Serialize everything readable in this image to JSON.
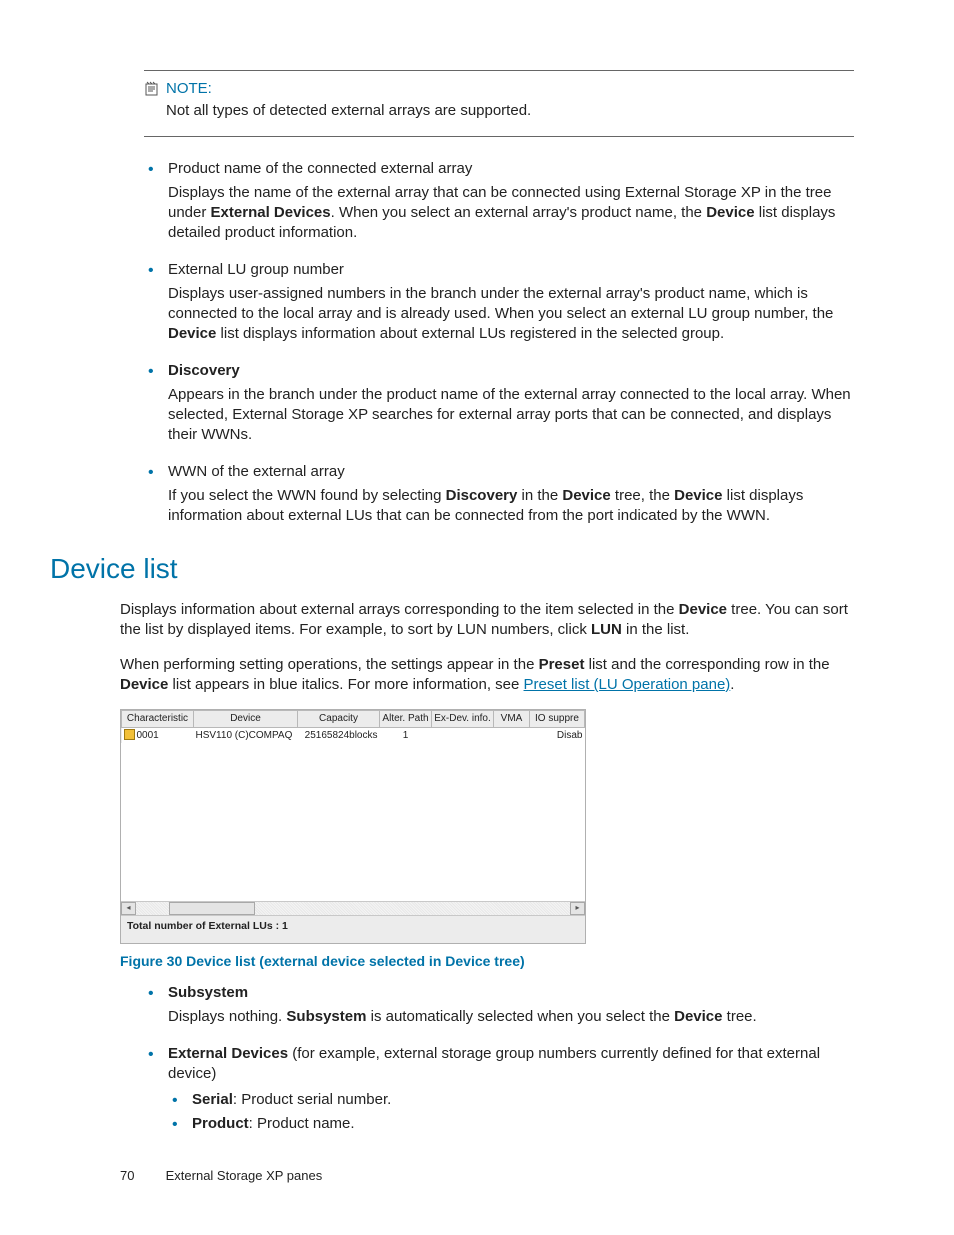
{
  "note": {
    "label": "NOTE:",
    "text": "Not all types of detected external arrays are supported."
  },
  "items": {
    "i0": {
      "head_a": "Product name of the connected external array",
      "body_a": "Displays the name of the external array that can be connected using External Storage XP in the tree under ",
      "body_b": "External Devices",
      "body_c": ". When you select an external array's product name, the ",
      "body_d": "Device",
      "body_e": " list displays detailed product information."
    },
    "i1": {
      "head_a": "External LU group number",
      "body_a": "Displays user-assigned numbers in the branch under the external array's product name, which is connected to the local array and is already used. When you select an external LU group number, the ",
      "body_b": "Device",
      "body_c": " list displays information about external LUs registered in the selected group."
    },
    "i2": {
      "head_a": "Discovery",
      "body_a": "Appears in the branch under the product name of the external array connected to the local array. When selected, External Storage XP searches for external array ports that can be connected, and displays their WWNs."
    },
    "i3": {
      "head_a": "WWN of the external array",
      "body_a": "If you select the WWN found by selecting ",
      "body_b": "Discovery",
      "body_c": " in the ",
      "body_d": "Device",
      "body_e": " tree, the ",
      "body_f": "Device",
      "body_g": " list displays information about external LUs that can be connected from the port indicated by the WWN."
    }
  },
  "section_heading": "Device list",
  "p1": {
    "a": "Displays information about external arrays corresponding to the item selected in the ",
    "b": "Device",
    "c": " tree. You can sort the list by displayed items. For example, to sort by LUN numbers, click ",
    "d": "LUN",
    "e": " in the list."
  },
  "p2": {
    "a": "When performing setting operations, the settings appear in the ",
    "b": "Preset",
    "c": " list and the corresponding row in the ",
    "d": "Device",
    "e": " list appears in blue italics. For more information, see ",
    "link": "Preset list (LU Operation pane)",
    "f": "."
  },
  "table": {
    "headers": [
      "Characteristic",
      "Device",
      "Capacity",
      "Alter. Path",
      "Ex-Dev. info.",
      "VMA",
      "IO suppre"
    ],
    "row": {
      "c0": "0001",
      "c1": "HSV110 (C)COMPAQ",
      "c2": "25165824blocks",
      "c3": "1",
      "c4": "",
      "c5": "",
      "c6": "Disab"
    },
    "footer": "Total number of External LUs : 1"
  },
  "caption": "Figure 30 Device list (external device selected in Device tree)",
  "items2": {
    "s0": {
      "head": "Subsystem",
      "body_a": "Displays nothing. ",
      "body_b": "Subsystem",
      "body_c": " is automatically selected when you select the ",
      "body_d": "Device",
      "body_e": " tree."
    },
    "s1": {
      "head": "External Devices",
      "body_a": " (for example, external storage group numbers currently defined for that external device)",
      "sub0_b": "Serial",
      "sub0_t": ": Product serial number.",
      "sub1_b": "Product",
      "sub1_t": ": Product name."
    }
  },
  "footer": {
    "page": "70",
    "title": "External Storage XP panes"
  }
}
